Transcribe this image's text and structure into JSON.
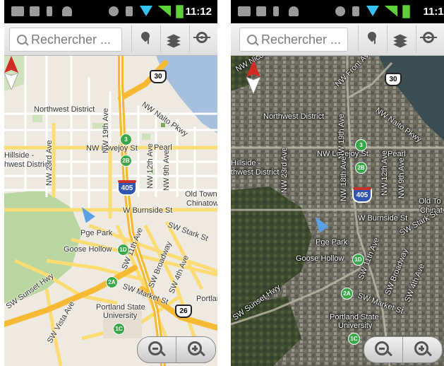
{
  "status_bar": {
    "time": "11:12",
    "icons": [
      "mail-icon",
      "calendar-icon",
      "usb-icon",
      "android-icon",
      "gps-icon",
      "vibrate-icon",
      "wifi-icon",
      "signal-icon",
      "battery-icon"
    ]
  },
  "search": {
    "placeholder": "Rechercher ..."
  },
  "toolbar": {
    "buttons": [
      "places-pin-icon",
      "layers-icon",
      "my-location-icon"
    ]
  },
  "colors": {
    "map_background": "#efeae1",
    "water": "#a6bfdd",
    "park": "#b9d6a0",
    "freeway": "#f6b934",
    "arterial": "#fbdc72",
    "satellite_base": "#5b5c50",
    "accent_location": "#5aa0e6"
  },
  "map_views": [
    {
      "mode": "map",
      "labels": {
        "nw_district": "Northwest District",
        "nw_lovejoy": "NW Lovejoy St",
        "pearl": "Pearl",
        "hillside": "Hillside -",
        "hillside2": "hwest District",
        "nw_23rd": "NW 23rd Ave",
        "nw_19th": "NW 19th Ave",
        "nw_12th": "NW 12th Ave",
        "nw_9th": "NW 9th Ave",
        "nw_naito": "NW Naito Pkwy",
        "old_town": "Old Town -",
        "chinatown": "Chinatown",
        "burnside": "W Burnside St",
        "stark": "SW Stark St",
        "pge_park": "Pge Park",
        "goose_hollow": "Goose Hollow",
        "sw_11th": "SW 11th Ave",
        "broadway": "SW Broadway",
        "sw_4th": "SW 4th Ave",
        "sw_market": "SW Market St",
        "portland_state": "Portland State",
        "university": "University",
        "sunset_hwy": "SW Sunset Hwy",
        "vista": "SW Vista Ave",
        "portland_cut": "Portlan"
      },
      "shields": {
        "us30": "30",
        "i405": "405",
        "us26": "26",
        "exit3": "3",
        "exit2b": "2B",
        "exit1d": "1D",
        "exit2a": "2A",
        "exit1c": "1C"
      }
    },
    {
      "mode": "satellite",
      "labels": {
        "nw_nicolai": "NW Nicolai St",
        "nw_front": "NW Front Ave",
        "nw_district": "Northwest District",
        "nw_lovejoy": "NW Lovejoy St",
        "pearl": "Pearl",
        "hillside": "Hillside -",
        "hillside2": "thwest District",
        "nw_23rd": "NW 23rd Ave",
        "nw_19th": "NW 19th Ave",
        "nw_18th": "NW 18th Ave",
        "nw_12th": "NW 12th Ave",
        "nw_9th": "NW 9th Ave",
        "nw_naito": "NW Naito Pkwy",
        "old_town": "Old To",
        "chinatown": "Chinat",
        "burnside": "W Burnside St",
        "stark": "SW Stark St",
        "pge_park": "Pge Park",
        "goose_hollow": "Goose Hollow",
        "sw_11th": "SW 11th Ave",
        "broadway": "SW Broadway",
        "sw_4th": "SW 4th Ave",
        "sw_market": "SW Market St",
        "portland_state": "Portland State",
        "university": "University",
        "sunset_hwy": "SW Sunset Hwy"
      },
      "shields": {
        "us30": "30",
        "i405": "405",
        "exit3": "3",
        "exit2b": "2B",
        "exit1d": "1D",
        "exit2a": "2A",
        "exit1c": "1C"
      }
    }
  ]
}
